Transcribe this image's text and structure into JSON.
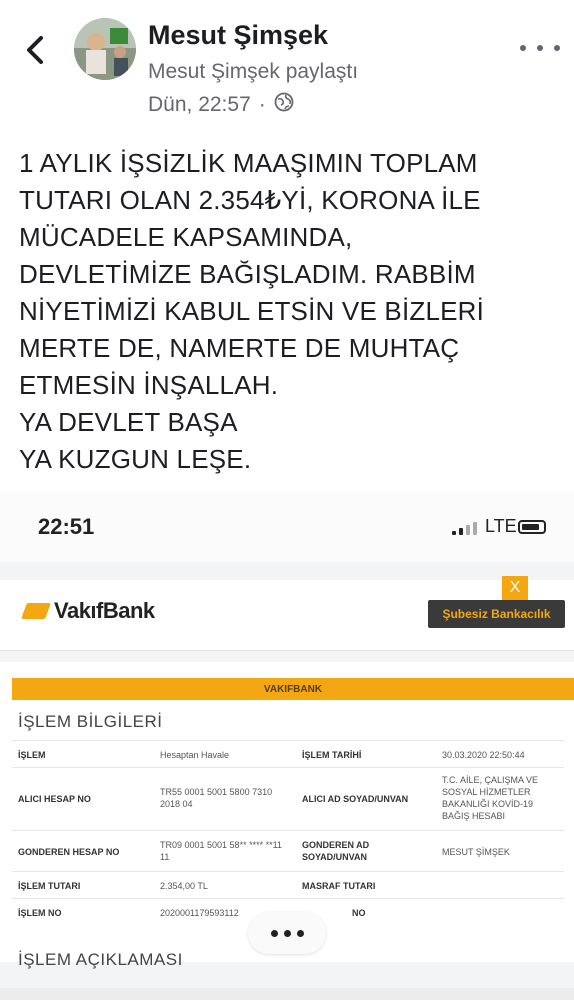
{
  "post": {
    "author": "Mesut Şimşek",
    "shared_by": "Mesut Şimşek paylaştı",
    "time": "Dün, 22:57",
    "separator": "·",
    "lines": [
      "1 AYLIK İŞSİZLİK MAAŞIMIN TOPLAM",
      "TUTARI OLAN 2.354₺Yİ, KORONA İLE",
      "MÜCADELE KAPSAMINDA,",
      "DEVLETİMİZE BAĞIŞLADIM. RABBİM",
      "NİYETİMİZİ KABUL ETSİN VE BİZLERİ",
      "MERTE DE, NAMERTE DE MUHTAÇ",
      "ETMESİN İNŞALLAH.",
      "YA DEVLET BAŞA",
      "YA KUZGUN LEŞE."
    ]
  },
  "screenshot": {
    "clock": "22:51",
    "network": "LTE",
    "bank_name": "VakıfBank",
    "close_label": "X",
    "branchless_label": "Şubesiz Bankacılık",
    "band_label": "VAKIFBANK",
    "section_title": "İŞLEM BİLGİLERİ",
    "section_title_2": "İŞLEM AÇIKLAMASI",
    "rows": [
      {
        "l1": "İŞLEM",
        "v1": "Hesaptan Havale",
        "l2": "İŞLEM TARİHİ",
        "v2": "30.03.2020 22:50:44"
      },
      {
        "l1": "ALICI HESAP NO",
        "v1": "TR55 0001 5001 5800 7310 2018 04",
        "l2": "ALICI AD SOYAD/UNVAN",
        "v2": "T.C. AİLE, ÇALIŞMA VE SOSYAL HİZMETLER BAKANLIĞI KOVİD-19 BAĞIŞ HESABI"
      },
      {
        "l1": "GONDEREN HESAP NO",
        "v1": "TR09 0001 5001 58** **** **11 11",
        "l2": "GONDEREN AD SOYAD/UNVAN",
        "v2": "MESUT ŞİMŞEK"
      },
      {
        "l1": "İŞLEM TUTARI",
        "v1": "2.354,00 TL",
        "l2": "MASRAF TUTARI",
        "v2": ""
      },
      {
        "l1": "İŞLEM NO",
        "v1": "2020001179593112",
        "l2": "NO",
        "v2": ""
      }
    ]
  },
  "colors": {
    "accent": "#f3a712",
    "text": "#1c1e21",
    "muted": "#65676b"
  }
}
